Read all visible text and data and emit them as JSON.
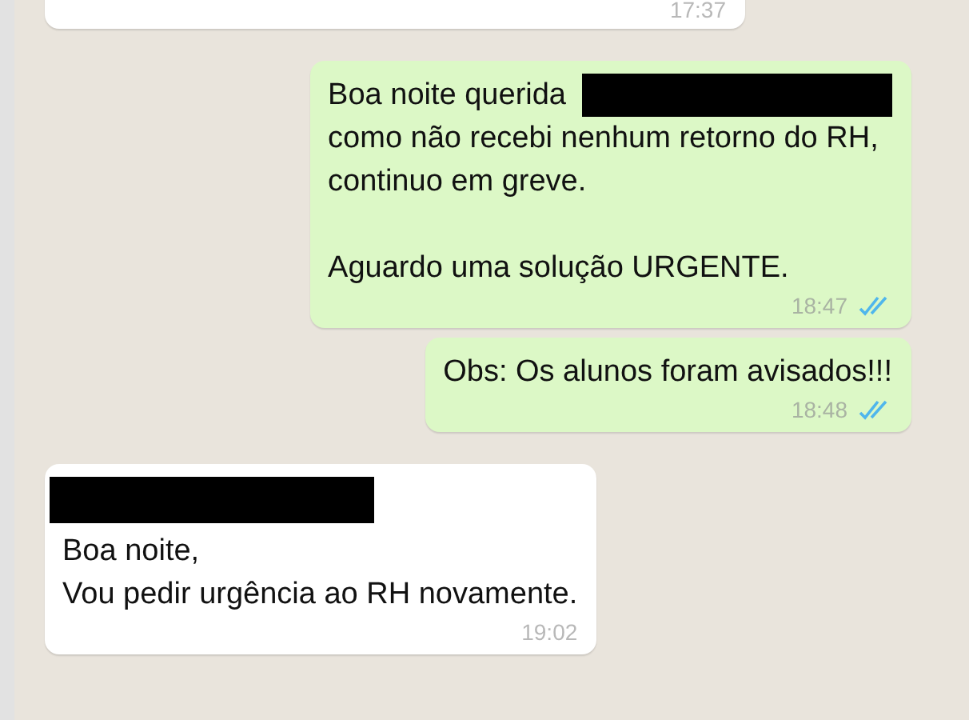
{
  "messages": [
    {
      "kind": "incoming",
      "cut_top": true,
      "time": "17:37"
    },
    {
      "kind": "outgoing",
      "paragraphs": [
        [
          {
            "text": "Boa noite querida",
            "redacted": true
          },
          {
            "text": "como não recebi nenhum retorno do RH,",
            "redacted": false
          },
          {
            "text": "continuo em greve.",
            "redacted": false
          }
        ],
        [
          {
            "text": "Aguardo uma solução URGENTE.",
            "redacted": false
          }
        ]
      ],
      "time": "18:47",
      "read": true
    },
    {
      "kind": "outgoing",
      "paragraphs": [
        [
          {
            "text": "Obs: Os alunos foram avisados!!!",
            "redacted": false
          }
        ]
      ],
      "time": "18:48",
      "read": true
    },
    {
      "kind": "incoming",
      "sender_redacted": true,
      "paragraphs": [
        [
          {
            "text": "Boa noite,",
            "redacted": false
          },
          {
            "text": "Vou pedir urgência ao RH novamente.",
            "redacted": false
          }
        ]
      ],
      "time": "19:02"
    }
  ]
}
